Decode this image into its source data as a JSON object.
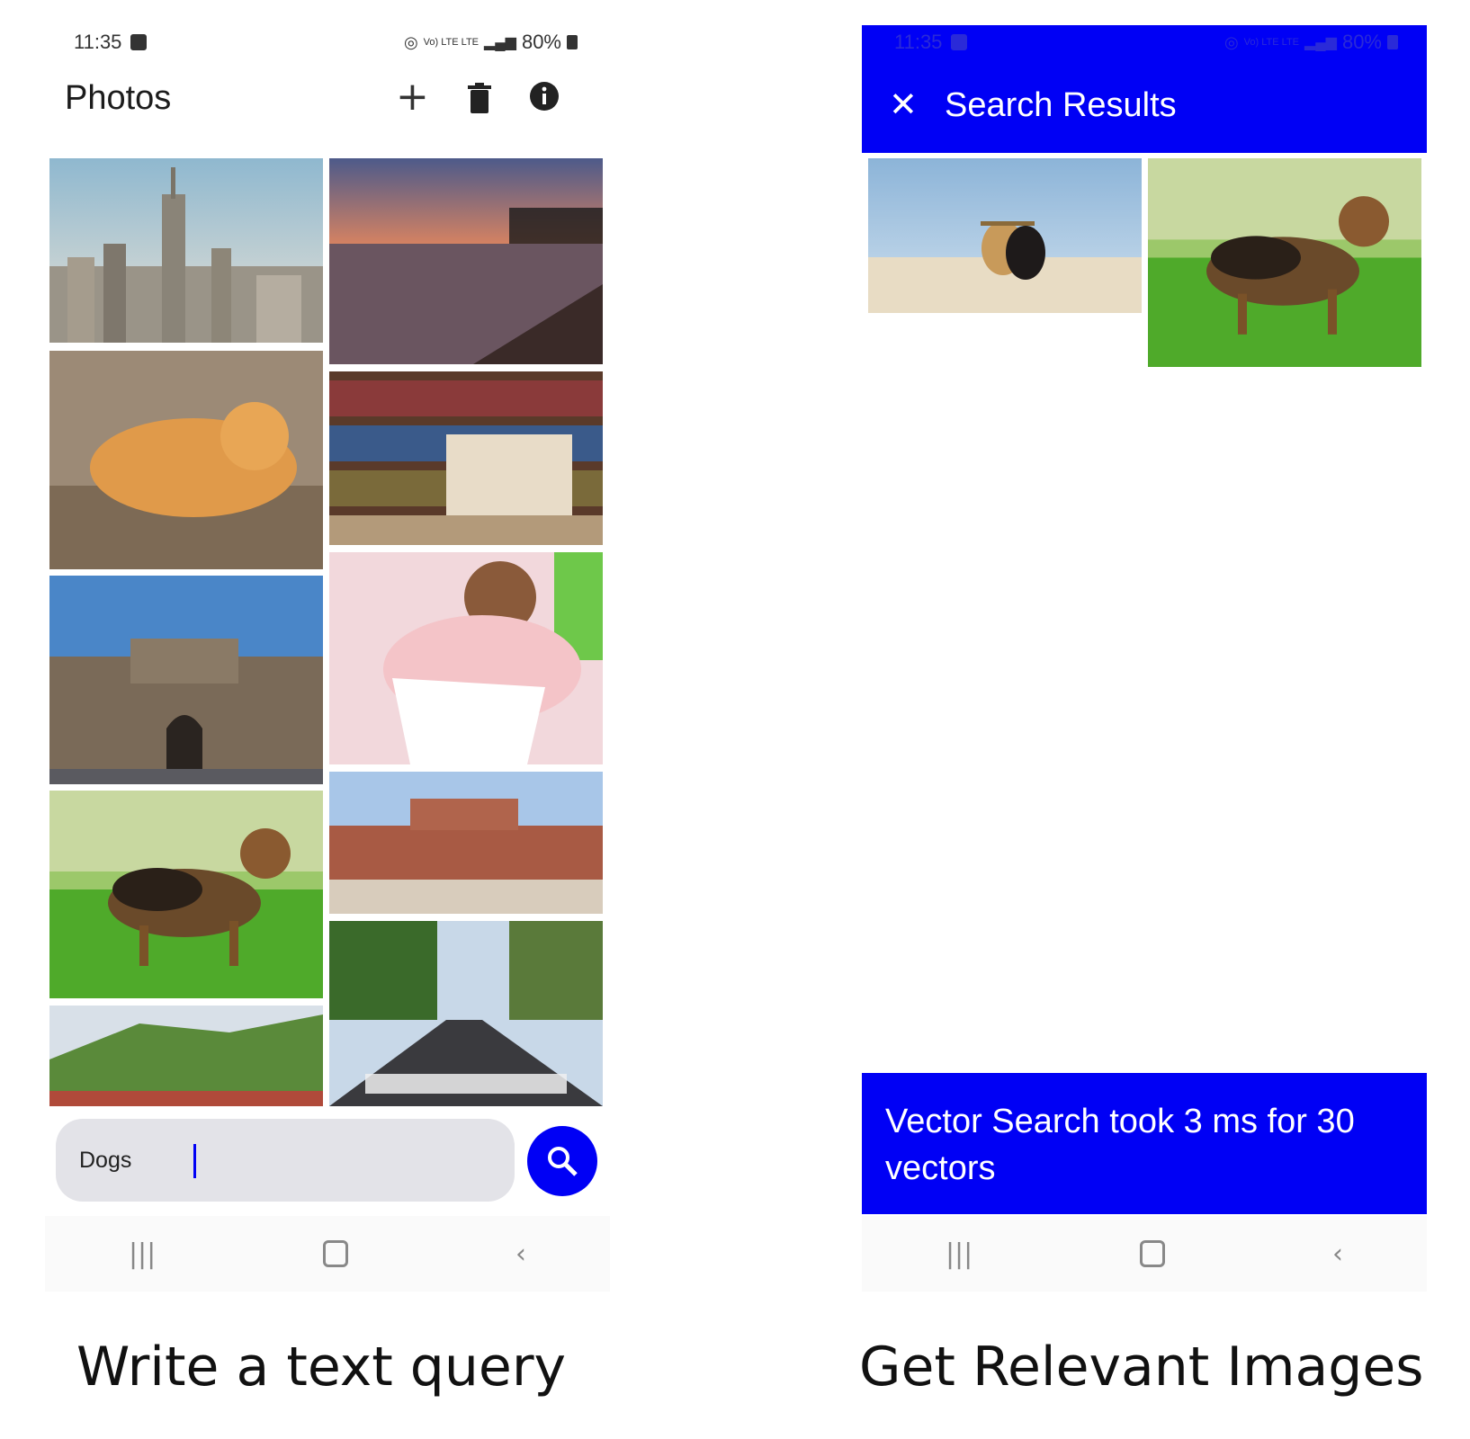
{
  "left_phone": {
    "status": {
      "time": "11:35",
      "network": "Vo) LTE LTE",
      "battery": "80%"
    },
    "app_bar": {
      "title": "Photos",
      "add_icon": "plus-icon",
      "delete_icon": "trash-icon",
      "info_icon": "info-icon"
    },
    "photos": [
      {
        "subject": "city skyline"
      },
      {
        "subject": "sunset beach"
      },
      {
        "subject": "orange cat"
      },
      {
        "subject": "books"
      },
      {
        "subject": "fort gate"
      },
      {
        "subject": "child drawing"
      },
      {
        "subject": "german shepherd"
      },
      {
        "subject": "red fort"
      },
      {
        "subject": "hillside trees"
      },
      {
        "subject": "street crossing"
      }
    ],
    "search": {
      "value": "Dogs",
      "button_icon": "search-icon"
    }
  },
  "right_phone": {
    "status": {
      "time": "11:35",
      "network": "Vo) LTE LTE",
      "battery": "80%"
    },
    "app_bar": {
      "title": "Search Results",
      "close_icon": "close-icon"
    },
    "results": [
      {
        "subject": "two dogs on beach"
      },
      {
        "subject": "german shepherd"
      }
    ],
    "snackbar": {
      "text": "Vector Search took 3 ms for 30 vectors"
    }
  },
  "captions": {
    "left": "Write a text query",
    "right": "Get Relevant Images"
  },
  "colors": {
    "accent": "#0000f5"
  }
}
